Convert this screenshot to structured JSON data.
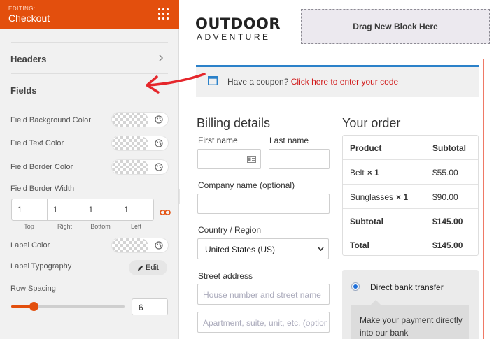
{
  "sidebar": {
    "editing_label": "EDITING:",
    "title": "Checkout",
    "sections": {
      "headers": "Headers",
      "fields": "Fields"
    },
    "color_rows": [
      {
        "label": "Field Background Color"
      },
      {
        "label": "Field Text Color"
      },
      {
        "label": "Field Border Color"
      }
    ],
    "border_width": {
      "label": "Field Border Width",
      "values": [
        "1",
        "1",
        "1",
        "1"
      ],
      "sides": [
        "Top",
        "Right",
        "Bottom",
        "Left"
      ]
    },
    "label_color": {
      "label": "Label Color"
    },
    "label_typography": {
      "label": "Label Typography",
      "button": "Edit"
    },
    "row_spacing": {
      "label": "Row Spacing",
      "value": "6",
      "fraction": 0.2
    },
    "accent_color": "#e34f0d"
  },
  "canvas": {
    "logo_line1": "OUTDOOR",
    "logo_line2": "ADVENTURE",
    "drag_block": "Drag New Block Here",
    "coupon": {
      "text": "Have a coupon?",
      "link": "Click here to enter your code"
    },
    "billing": {
      "title": "Billing details",
      "first_name": "First name",
      "last_name": "Last name",
      "company": "Company name (optional)",
      "country_label": "Country / Region",
      "country_value": "United States (US)",
      "street_label": "Street address",
      "street_placeholder_1": "House number and street name",
      "street_placeholder_2": "Apartment, suite, unit, etc. (optional)"
    },
    "order": {
      "title": "Your order",
      "headers": [
        "Product",
        "Subtotal"
      ],
      "rows": [
        {
          "product": "Belt",
          "qty": "× 1",
          "subtotal": "$55.00"
        },
        {
          "product": "Sunglasses",
          "qty": "× 1",
          "subtotal": "$90.00"
        }
      ],
      "subtotal_label": "Subtotal",
      "subtotal_value": "$145.00",
      "total_label": "Total",
      "total_value": "$145.00"
    },
    "payment": {
      "method": "Direct bank transfer",
      "description": "Make your payment directly into our bank"
    }
  }
}
